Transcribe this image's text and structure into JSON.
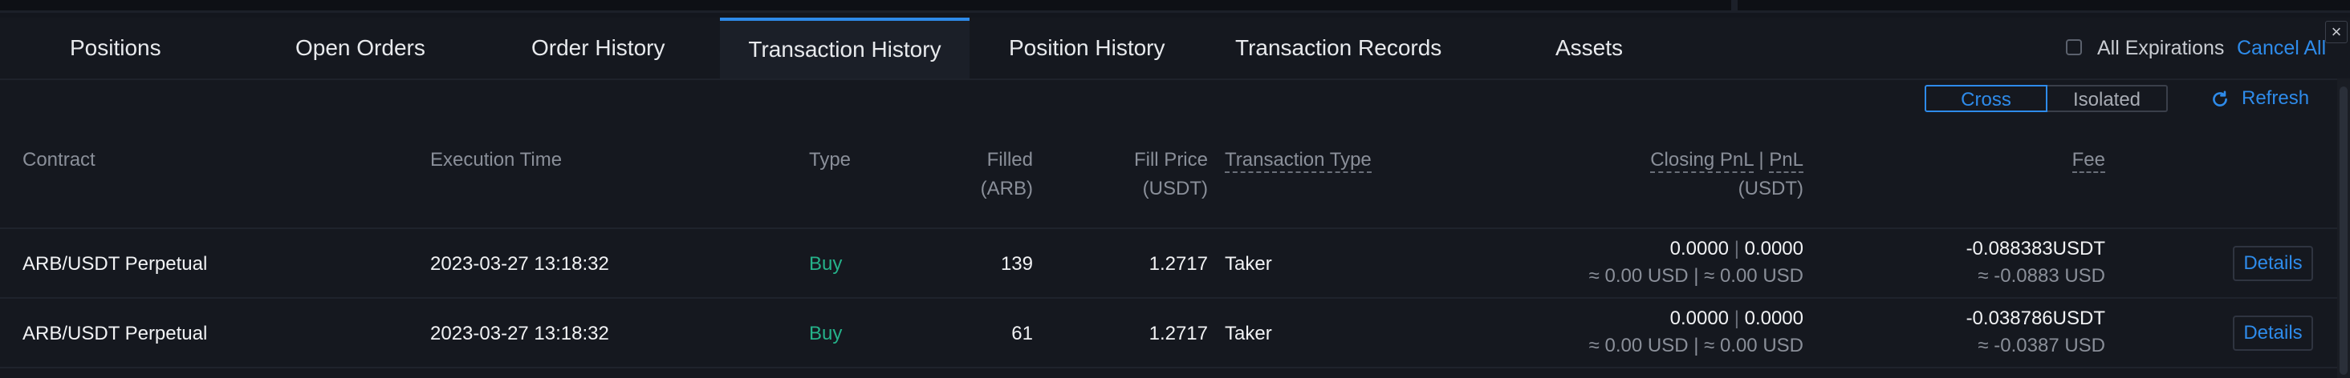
{
  "tabs": [
    "Positions",
    "Open Orders",
    "Order History",
    "Transaction History",
    "Position History",
    "Transaction Records",
    "Assets"
  ],
  "active_tab": "Transaction History",
  "toolbar": {
    "all_expirations": "All Expirations",
    "cancel_all": "Cancel All",
    "close_symbol": "×",
    "margin_modes": [
      "Cross",
      "Isolated"
    ],
    "selected_margin_mode": "Cross",
    "refresh": "Refresh"
  },
  "table": {
    "headers": {
      "contract": "Contract",
      "execution_time": "Execution Time",
      "type": "Type",
      "filled": "Filled",
      "filled_unit": "(ARB)",
      "fill_price": "Fill Price",
      "fill_price_unit": "(USDT)",
      "transaction_type": "Transaction Type",
      "closing_pnl": "Closing PnL",
      "pnl": "PnL",
      "pnl_unit": "(USDT)",
      "fee": "Fee"
    },
    "rows": [
      {
        "contract": "ARB/USDT Perpetual",
        "execution_time": "2023-03-27 13:18:32",
        "type": "Buy",
        "filled": "139",
        "fill_price": "1.2717",
        "transaction_type": "Taker",
        "closing_pnl": "0.0000",
        "pnl": "0.0000",
        "pnl_usd": "≈ 0.00 USD | ≈ 0.00 USD",
        "fee": "-0.088383USDT",
        "fee_usd": "≈ -0.0883 USD",
        "action": "Details"
      },
      {
        "contract": "ARB/USDT Perpetual",
        "execution_time": "2023-03-27 13:18:32",
        "type": "Buy",
        "filled": "61",
        "fill_price": "1.2717",
        "transaction_type": "Taker",
        "closing_pnl": "0.0000",
        "pnl": "0.0000",
        "pnl_usd": "≈ 0.00 USD | ≈ 0.00 USD",
        "fee": "-0.038786USDT",
        "fee_usd": "≈ -0.0387 USD",
        "action": "Details"
      }
    ]
  },
  "colors": {
    "background": "#13161d",
    "accent": "#2e8bea",
    "buy": "#25b28a",
    "muted_text": "#8a8f99",
    "primary_text": "#e8eaed"
  }
}
